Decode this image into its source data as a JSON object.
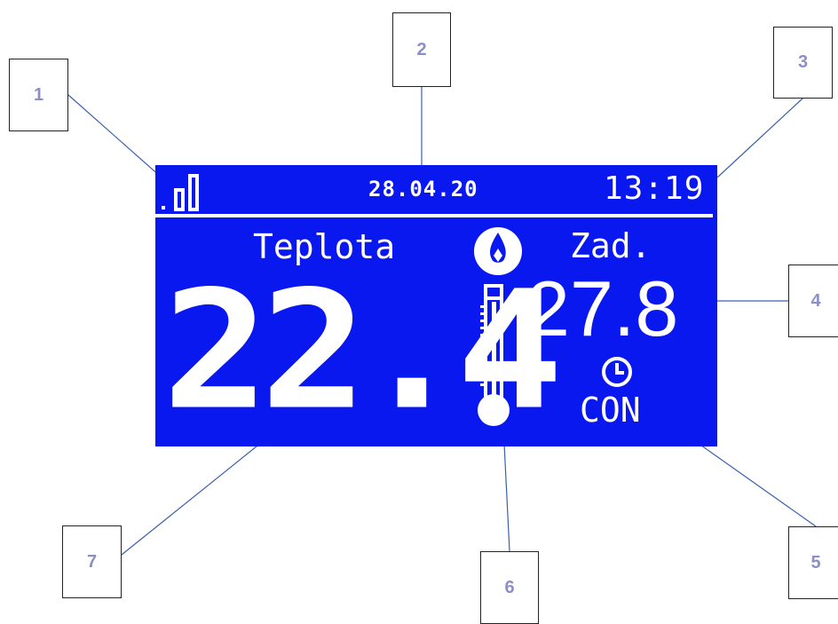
{
  "display": {
    "date": "28.04.20",
    "time": "13:19",
    "current_temp_label": "Teplota",
    "current_temp_value": "22.4",
    "setpoint_label": "Zad.",
    "setpoint_value": "27.8",
    "mode": "CON",
    "icons": [
      "signal-strength-icon",
      "burner-flame-icon",
      "thermometer-icon",
      "clock-icon"
    ],
    "background_color": "#0a18f0",
    "foreground_color": "#ffffff"
  },
  "callouts": [
    {
      "number": "1"
    },
    {
      "number": "2"
    },
    {
      "number": "3"
    },
    {
      "number": "4"
    },
    {
      "number": "5"
    },
    {
      "number": "6"
    },
    {
      "number": "7"
    }
  ],
  "callout_color": "#8b8fc6",
  "line_color": "#3a5fb0"
}
